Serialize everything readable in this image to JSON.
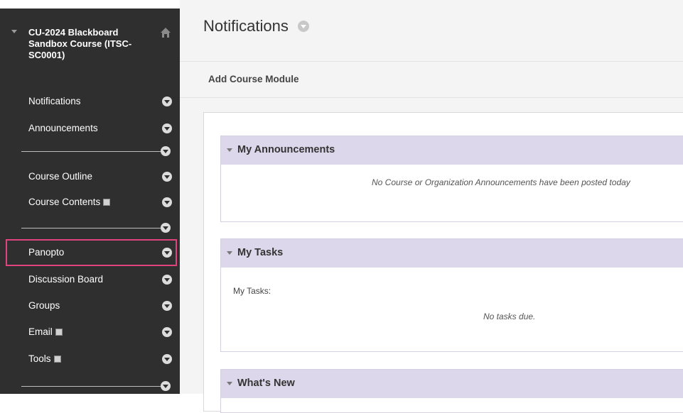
{
  "sidebar": {
    "course_title": "CU-2024 Blackboard\nSandbox Course (ITSC-\nSC0001)",
    "items": [
      {
        "label": "Notifications"
      },
      {
        "label": "Announcements"
      },
      {
        "label": "Course Outline"
      },
      {
        "label": "Course Contents"
      },
      {
        "label": "Panopto"
      },
      {
        "label": "Discussion Board"
      },
      {
        "label": "Groups"
      },
      {
        "label": "Email"
      },
      {
        "label": "Tools"
      }
    ]
  },
  "main": {
    "page_title": "Notifications",
    "toolbar": {
      "add_module_label": "Add Course Module"
    },
    "modules": [
      {
        "title": "My Announcements",
        "message": "No Course or Organization Announcements have been posted today"
      },
      {
        "title": "My Tasks",
        "label": "My Tasks:",
        "message": "No tasks due."
      },
      {
        "title": "What's New"
      }
    ]
  },
  "colors": {
    "sidebar_bg": "#2f2f2f",
    "module_header_bg": "#dcd7ea",
    "highlight_border": "#e0447f"
  },
  "icons": {
    "home": "home-icon",
    "menu": "chevron-down-circle-icon"
  }
}
